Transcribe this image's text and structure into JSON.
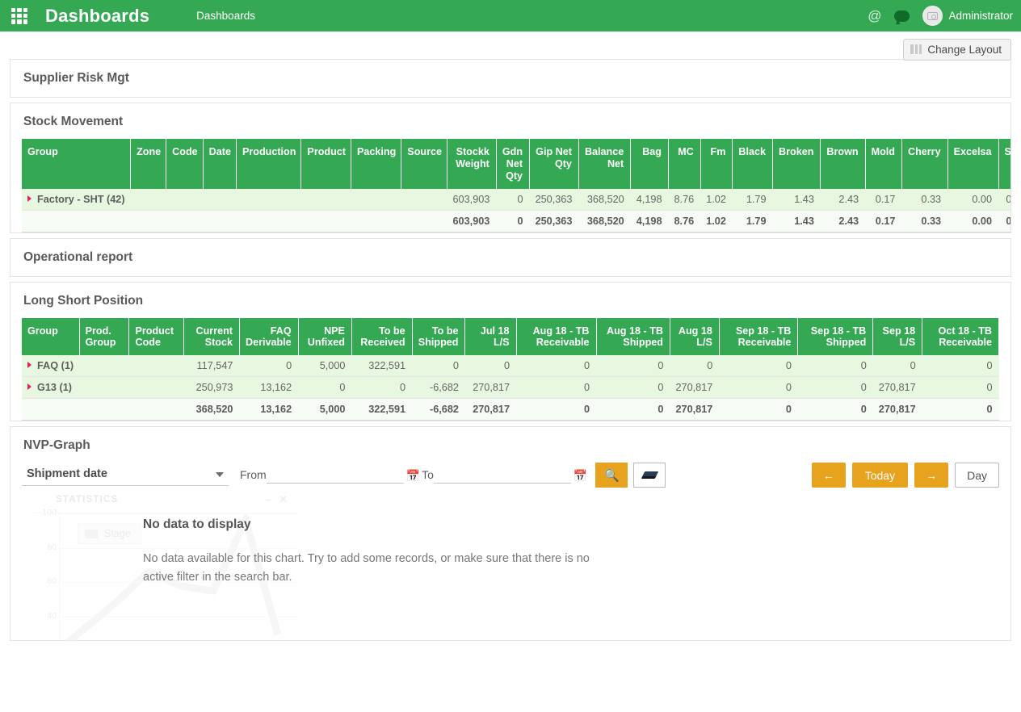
{
  "header": {
    "grid_icon": "apps-grid-icon",
    "title": "Dashboards",
    "breadcrumb": "Dashboards",
    "mention_icon": "@",
    "chat_icon": "chat-bubble-icon",
    "avatar_icon": "camera-avatar-icon",
    "user_name": "Administrator",
    "brand_color": "#34a853"
  },
  "toolbar": {
    "change_layout_label": "Change Layout",
    "layout_icon": "columns-icon"
  },
  "panels": {
    "supplier_risk": {
      "title": "Supplier Risk Mgt"
    },
    "stock_movement": {
      "title": "Stock Movement"
    },
    "operational_report": {
      "title": "Operational report"
    },
    "long_short": {
      "title": "Long Short Position"
    },
    "nvp_graph": {
      "title": "NVP-Graph"
    }
  },
  "stock_movement_table": {
    "columns": [
      "Group",
      "Zone",
      "Code",
      "Date",
      "Production",
      "Product",
      "Packing",
      "Source",
      "Stockk Weight",
      "Gdn Net Qty",
      "Gip Net Qty",
      "Balance Net",
      "Bag",
      "MC",
      "Fm",
      "Black",
      "Broken",
      "Brown",
      "Mold",
      "Cherry",
      "Excelsa",
      "S"
    ],
    "rows": [
      {
        "group": "Factory - SHT (42)",
        "expandable": true,
        "values": [
          "",
          "",
          "",
          "",
          "",
          "",
          "",
          "603,903",
          "0",
          "250,363",
          "368,520",
          "4,198",
          "8.76",
          "1.02",
          "1.79",
          "1.43",
          "2.43",
          "0.17",
          "0.33",
          "0.00",
          "0"
        ]
      }
    ],
    "total": {
      "group": "",
      "values": [
        "",
        "",
        "",
        "",
        "",
        "",
        "",
        "603,903",
        "0",
        "250,363",
        "368,520",
        "4,198",
        "8.76",
        "1.02",
        "1.79",
        "1.43",
        "2.43",
        "0.17",
        "0.33",
        "0.00",
        "0"
      ]
    }
  },
  "long_short_table": {
    "columns": [
      "Group",
      "Prod. Group",
      "Product Code",
      "Current Stock",
      "FAQ Derivable",
      "NPE Unfixed",
      "To be Received",
      "To be Shipped",
      "Jul 18 L/S",
      "Aug 18 - TB Receivable",
      "Aug 18 - TB Shipped",
      "Aug 18 L/S",
      "Sep 18 - TB Receivable",
      "Sep 18 - TB Shipped",
      "Sep 18 L/S",
      "Oct 18 - TB Receivable"
    ],
    "rows": [
      {
        "group": "FAQ (1)",
        "expandable": true,
        "values": [
          "",
          "",
          "117,547",
          "0",
          "5,000",
          "322,591",
          "0",
          "0",
          "0",
          "0",
          "0",
          "0",
          "0",
          "0",
          "0"
        ]
      },
      {
        "group": "G13 (1)",
        "expandable": true,
        "values": [
          "",
          "",
          "250,973",
          "13,162",
          "0",
          "0",
          "-6,682",
          "270,817",
          "0",
          "0",
          "270,817",
          "0",
          "0",
          "270,817",
          "0"
        ]
      }
    ],
    "total": {
      "group": "",
      "values": [
        "",
        "",
        "368,520",
        "13,162",
        "5,000",
        "322,591",
        "-6,682",
        "270,817",
        "0",
        "0",
        "270,817",
        "0",
        "0",
        "270,817",
        "0"
      ]
    }
  },
  "nvp_controls": {
    "measure_selected": "Shipment date",
    "measure_options": [
      "Shipment date"
    ],
    "from_label": "From",
    "from_value": "",
    "from_placeholder": "",
    "to_label": "To",
    "to_value": "",
    "to_placeholder": "",
    "calendar_icon": "calendar-icon",
    "search_icon": "search-icon",
    "eraser_icon": "eraser-icon",
    "prev_label": "←",
    "today_label": "Today",
    "next_label": "→",
    "scale_label": "Day",
    "accent_color": "#e8a31e"
  },
  "chart_data": {
    "type": "line",
    "title": "STATISTICS",
    "watermark": true,
    "legend": [
      "Stage"
    ],
    "legend_position": "top-left",
    "grid": true,
    "ylim": [
      20,
      100
    ],
    "yticks": [
      100,
      80,
      60,
      40
    ],
    "x": [],
    "series": [
      {
        "name": "Stage",
        "values": []
      }
    ],
    "empty_state": {
      "heading": "No data to display",
      "message": "No data available for this chart. Try to add some records, or make sure that there is no active filter in the search bar."
    }
  }
}
